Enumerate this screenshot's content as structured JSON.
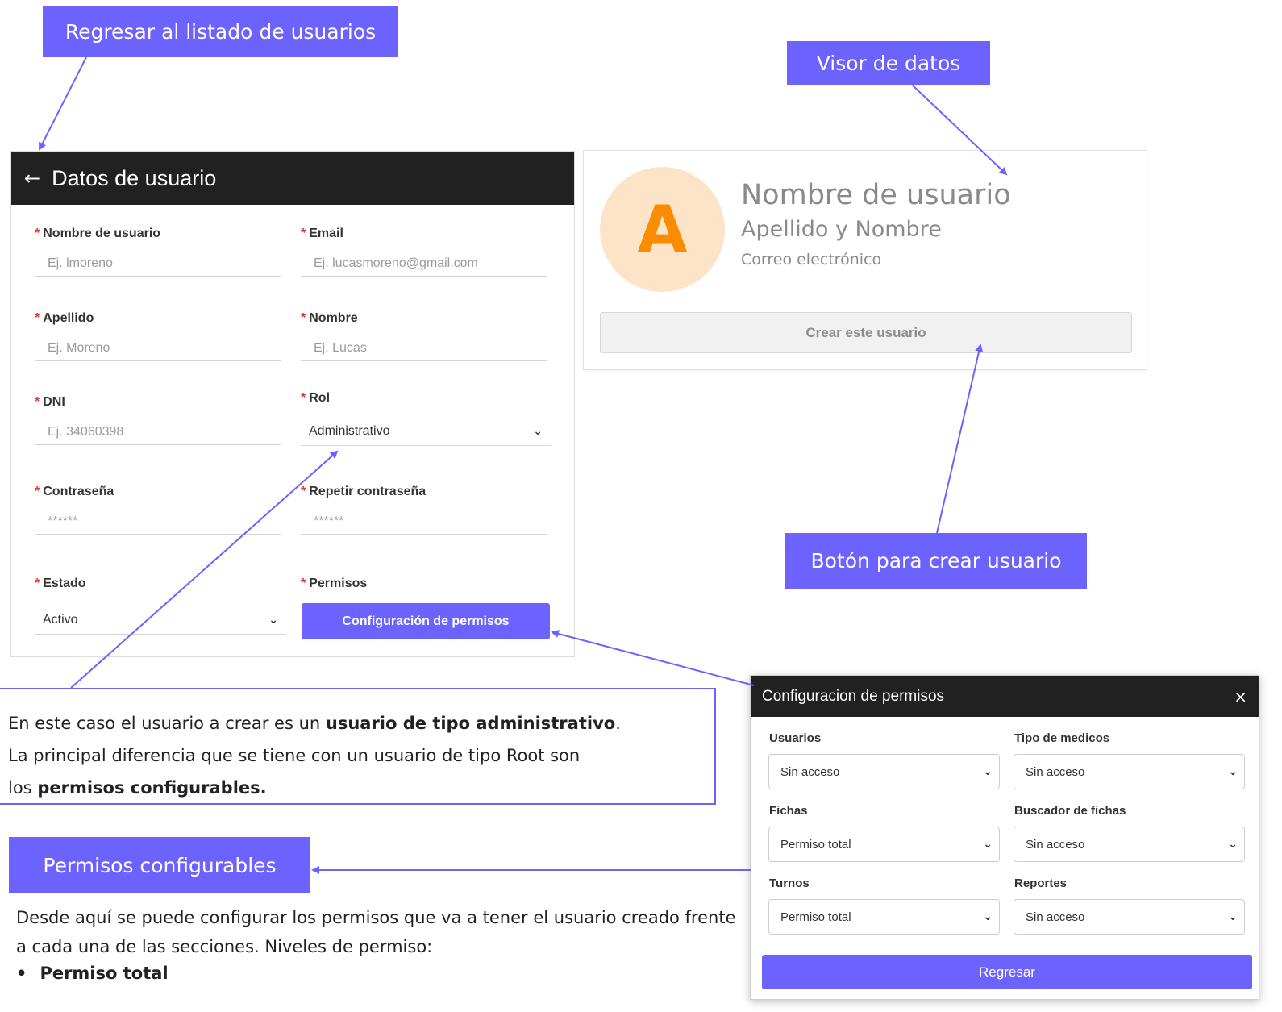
{
  "callouts": {
    "back": "Regresar al listado de usuarios",
    "viewer": "Visor de datos",
    "create": "Botón para crear usuario",
    "permissions": "Permisos configurables"
  },
  "form": {
    "title": "Datos de usuario",
    "back_icon": "arrow-left-icon",
    "fields": {
      "username": {
        "label": "Nombre de usuario",
        "placeholder": "Ej. lmoreno"
      },
      "email": {
        "label": "Email",
        "placeholder": "Ej. lucasmoreno@gmail.com"
      },
      "lastname": {
        "label": "Apellido",
        "placeholder": "Ej. Moreno"
      },
      "firstname": {
        "label": "Nombre",
        "placeholder": "Ej. Lucas"
      },
      "dni": {
        "label": "DNI",
        "placeholder": "Ej. 34060398"
      },
      "role": {
        "label": "Rol",
        "value": "Administrativo"
      },
      "password": {
        "label": "Contraseña",
        "placeholder": "******"
      },
      "password_repeat": {
        "label": "Repetir contraseña",
        "placeholder": "******"
      },
      "status": {
        "label": "Estado",
        "value": "Activo"
      },
      "permissions": {
        "label": "Permisos",
        "button": "Configuración de permisos"
      }
    },
    "required_mark": "*"
  },
  "viewer": {
    "avatar_letter": "A",
    "username": "Nombre de usuario",
    "fullname": "Apellido y Nombre",
    "email": "Correo electrónico",
    "create_button": "Crear este usuario"
  },
  "explanation": {
    "part1": "En este caso el usuario a crear es un ",
    "bold1": "usuario de tipo administrativo",
    "part2": ".",
    "part3": "La principal diferencia que se tiene con un usuario de tipo Root son",
    "part4": "los ",
    "bold2": "permisos configurables."
  },
  "description": {
    "text": "Desde aquí se puede configurar los permisos que va a tener el usuario creado frente a cada una de las secciones. Niveles de permiso:",
    "bullet": "•",
    "bullet_item": "Permiso total"
  },
  "modal": {
    "title": "Configuracion de permisos",
    "close_icon": "×",
    "sections": [
      {
        "label": "Usuarios",
        "value": "Sin acceso"
      },
      {
        "label": "Tipo de medicos",
        "value": "Sin acceso"
      },
      {
        "label": "Fichas",
        "value": "Permiso total"
      },
      {
        "label": "Buscador de fichas",
        "value": "Sin acceso"
      },
      {
        "label": "Turnos",
        "value": "Permiso total"
      },
      {
        "label": "Reportes",
        "value": "Sin acceso"
      }
    ],
    "back_button": "Regresar"
  },
  "colors": {
    "accent": "#6c63ff",
    "header_bg": "#212121",
    "required": "#e53935",
    "avatar_bg": "#fde3c8",
    "avatar_letter": "#fb8c00"
  }
}
